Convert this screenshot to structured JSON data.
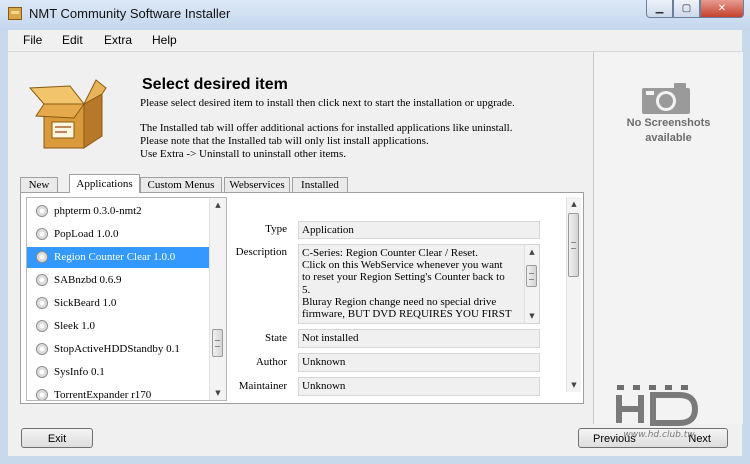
{
  "window": {
    "title": "NMT Community Software Installer"
  },
  "menu": [
    "File",
    "Edit",
    "Extra",
    "Help"
  ],
  "header": {
    "title": "Select desired item",
    "lines": [
      "Please select desired item to install then click next to start the installation or upgrade.",
      "The Installed tab will offer additional actions for installed applications like uninstall.",
      "Please note that the Installed tab will only list install applications.",
      "Use Extra -> Uninstall to uninstall other items."
    ]
  },
  "screenshot": {
    "line1": "No Screenshots",
    "line2": "available"
  },
  "tabs": [
    "New",
    "Applications",
    "Custom Menus",
    "Webservices",
    "Installed"
  ],
  "active_tab": "Applications",
  "items": [
    "phpterm 0.3.0-nmt2",
    "PopLoad 1.0.0",
    "Region Counter Clear 1.0.0",
    "SABnzbd 0.6.9",
    "SickBeard 1.0",
    "Sleek 1.0",
    "StopActiveHDDStandby 0.1",
    "SysInfo 0.1",
    "TorrentExpander r170"
  ],
  "selected_item": "Region Counter Clear 1.0.0",
  "details": {
    "type_label": "Type",
    "type_value": "Application",
    "description_label": "Description",
    "description_lines": [
      "C-Series: Region Counter Clear / Reset.",
      "Click on this WebService whenever you want",
      "to reset your Region Setting's Counter back to",
      "5.",
      "Bluray Region change need no special drive",
      "firmware, BUT DVD REQUIRES YOU FIRST"
    ],
    "state_label": "State",
    "state_value": "Not installed",
    "author_label": "Author",
    "author_value": "Unknown",
    "maintainer_label": "Maintainer",
    "maintainer_value": "Unknown"
  },
  "buttons": {
    "exit": "Exit",
    "previous": "Previous",
    "next": "Next"
  },
  "watermark": {
    "text": "www.hd.club.tw"
  }
}
